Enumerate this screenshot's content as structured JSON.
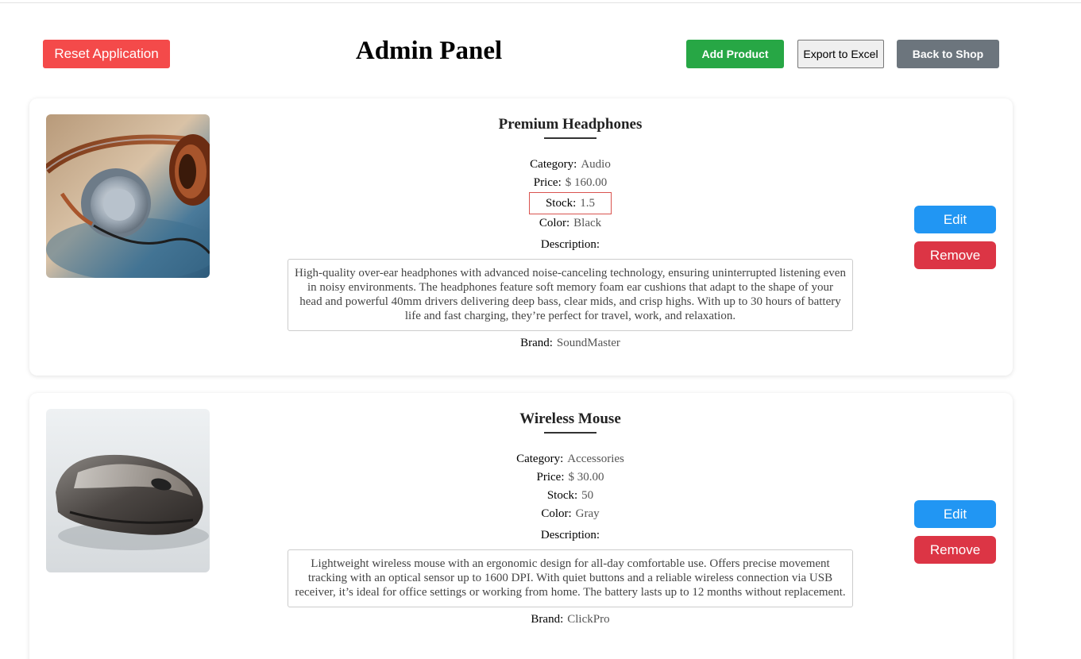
{
  "header": {
    "reset_label": "Reset Application",
    "title": "Admin Panel",
    "add_label": "Add Product",
    "export_label": "Export to Excel",
    "back_label": "Back to Shop"
  },
  "labels": {
    "category": "Category:",
    "price": "Price:",
    "stock": "Stock:",
    "color": "Color:",
    "description": "Description:",
    "brand": "Brand:",
    "edit": "Edit",
    "remove": "Remove"
  },
  "products": [
    {
      "name": "Premium Headphones",
      "category": "Audio",
      "price": "$ 160.00",
      "stock": "1.5",
      "color": "Black",
      "description": "High-quality over-ear headphones with advanced noise-canceling technology, ensuring uninterrupted listening even in noisy environments. The headphones feature soft memory foam ear cushions that adapt to the shape of your head and powerful 40mm drivers delivering deep bass, clear mids, and crisp highs. With up to 30 hours of battery life and fast charging, they’re perfect for travel, work, and relaxation.",
      "brand": "SoundMaster",
      "image": "headphones-photo"
    },
    {
      "name": "Wireless Mouse",
      "category": "Accessories",
      "price": "$ 30.00",
      "stock": "50",
      "color": "Gray",
      "description": "Lightweight wireless mouse with an ergonomic design for all-day comfortable use. Offers precise movement tracking with an optical sensor up to 1600 DPI. With quiet buttons and a reliable wireless connection via USB receiver, it’s ideal for office settings or working from home. The battery lasts up to 12 months without replacement.",
      "brand": "ClickPro",
      "image": "mouse-photo"
    }
  ],
  "colors": {
    "reset": "#f44a4a",
    "add": "#27a745",
    "back": "#6c757d",
    "edit": "#2196f3",
    "remove": "#dc3545",
    "highlight": "#d9534f"
  }
}
